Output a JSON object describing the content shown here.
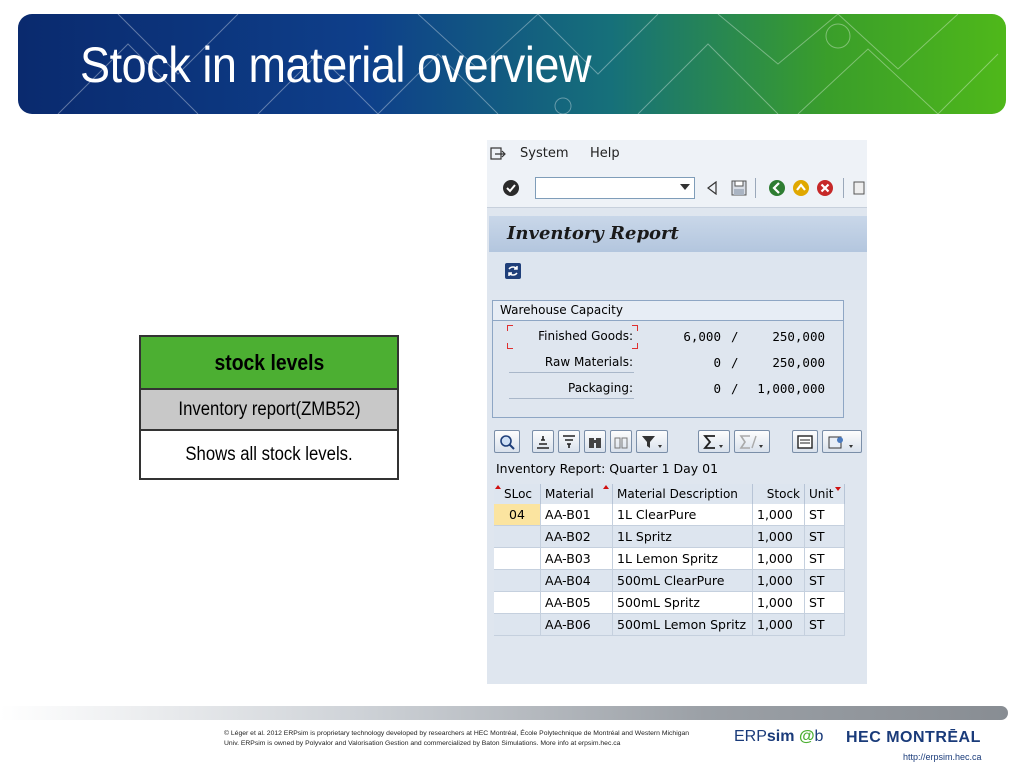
{
  "slide": {
    "title": "Stock in material overview"
  },
  "legend": {
    "header": "stock levels",
    "transaction": "Inventory report(ZMB52)",
    "description": "Shows all stock levels."
  },
  "sap": {
    "menu": {
      "system": "System",
      "help": "Help"
    },
    "command_value": "",
    "screen_title": "Inventory Report",
    "group_title": "Warehouse Capacity",
    "capacity": [
      {
        "label": "Finished Goods:",
        "current": "6,000",
        "sep": "/",
        "max": "250,000"
      },
      {
        "label": "Raw Materials:",
        "current": "0",
        "sep": "/",
        "max": "250,000"
      },
      {
        "label": "Packaging:",
        "current": "0",
        "sep": "/",
        "max": "1,000,000"
      }
    ],
    "report_title": "Inventory Report: Quarter 1 Day 01",
    "columns": {
      "sloc": "SLoc",
      "material": "Material",
      "description": "Material Description",
      "stock": "Stock",
      "unit": "Unit"
    },
    "rows": [
      {
        "sloc": "04",
        "material": "AA-B01",
        "description": "1L ClearPure",
        "stock": "1,000",
        "unit": "ST"
      },
      {
        "sloc": "",
        "material": "AA-B02",
        "description": "1L Spritz",
        "stock": "1,000",
        "unit": "ST"
      },
      {
        "sloc": "",
        "material": "AA-B03",
        "description": "1L Lemon Spritz",
        "stock": "1,000",
        "unit": "ST"
      },
      {
        "sloc": "",
        "material": "AA-B04",
        "description": "500mL ClearPure",
        "stock": "1,000",
        "unit": "ST"
      },
      {
        "sloc": "",
        "material": "AA-B05",
        "description": "500mL Spritz",
        "stock": "1,000",
        "unit": "ST"
      },
      {
        "sloc": "",
        "material": "AA-B06",
        "description": "500mL Lemon Spritz",
        "stock": "1,000",
        "unit": "ST"
      }
    ]
  },
  "footer": {
    "copyright_line1": "© Léger et al. 2012 ERPsim is proprietary technology developed by researchers at HEC Montréal, École Polytechnique de Montréal and Western Michigan",
    "copyright_line2": "Univ. ERPsim is owned by Polyvalor and Valorisation Gestion and commercialized by Baton Simulations. More info at erpsim.hec.ca",
    "logo_erp": "ERP",
    "logo_sim": "sim",
    "logo_at": "@",
    "logo_b": "b",
    "logo_hec": "HEC MONTRĒAL",
    "url": "http://erpsim.hec.ca"
  },
  "colors": {
    "banner_start": "#0a2a6e",
    "banner_end": "#4fb81a",
    "legend_header": "#4caf32",
    "legend_sub": "#c8c8c8",
    "sloc_highlight": "#fbe4a0"
  }
}
